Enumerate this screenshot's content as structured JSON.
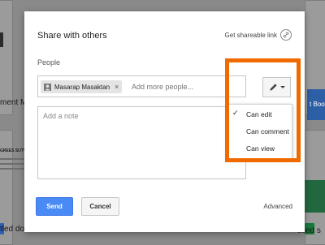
{
  "background": {
    "card_labels": [
      "ment Mo",
      "GREES SUTVE",
      "tled docu",
      "titled s"
    ],
    "blue_card_text": "t Boo"
  },
  "dialog": {
    "title": "Share with others",
    "shareable_link_label": "Get shareable link",
    "people_label": "People",
    "chip_name": "Masarap Masaktan",
    "chip_close": "×",
    "people_placeholder": "Add more people...",
    "note_placeholder": "Add a note",
    "send_label": "Send",
    "cancel_label": "Cancel",
    "advanced_label": "Advanced"
  },
  "permission_menu": {
    "check": "✓",
    "items": [
      {
        "label": "Can edit",
        "selected": true
      },
      {
        "label": "Can comment",
        "selected": false
      },
      {
        "label": "Can view",
        "selected": false
      }
    ]
  },
  "colors": {
    "accent": "#4a8af4",
    "highlight": "#f06a00"
  },
  "icons": [
    "link-icon",
    "person-icon",
    "pencil-icon",
    "caret-down-icon",
    "check-icon"
  ]
}
